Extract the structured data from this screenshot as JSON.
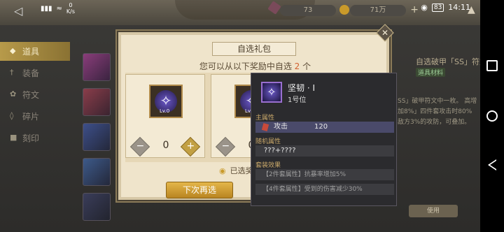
{
  "status_bar": {
    "speed_value": "0",
    "speed_unit": "K/s",
    "battery": "83",
    "time": "14:11"
  },
  "top_bar": {
    "resource_1": "73",
    "resource_2": "71万"
  },
  "sidebar": {
    "items": [
      {
        "label": "道具",
        "icon": "bag-icon",
        "active": true
      },
      {
        "label": "装备",
        "icon": "sword-icon",
        "active": false
      },
      {
        "label": "符文",
        "icon": "rune-icon",
        "active": false
      },
      {
        "label": "碎片",
        "icon": "shard-icon",
        "active": false
      },
      {
        "label": "刻印",
        "icon": "stamp-icon",
        "active": false
      }
    ]
  },
  "right_panel": {
    "title": "自选破甲「SS」符文",
    "tag": "道具材料",
    "desc": "SS」破甲符文中一枚。 高增加8%」四件套攻击时80% 敌方3%的攻防，可叠加。",
    "button": "使用"
  },
  "dialog": {
    "title": "自选礼包",
    "subtitle_prefix": "您可以从以下奖励中自选",
    "subtitle_count": "2",
    "subtitle_suffix": "个",
    "cards": [
      {
        "level": "Lv.0",
        "quantity": "0"
      },
      {
        "level": "Lv.0",
        "quantity": "0"
      }
    ],
    "selected_note": "已选奖",
    "reselect_button": "下次再选",
    "close_glyph": "✕"
  },
  "tooltip": {
    "name": "坚韧 · Ⅰ",
    "slot": "1号位",
    "main_attr_label": "主属性",
    "main_attr_key": "攻击",
    "main_attr_value": "120",
    "random_attr_label": "随机属性",
    "random_attr_value": "???+????",
    "set_effect_label": "套装效果",
    "set_effects": [
      "【2件套属性】抗暴率增加5%",
      "【4件套属性】受到的伤害减少30%"
    ]
  },
  "colors": {
    "accent_gold": "#c2a043",
    "highlight_orange": "#d1602f"
  }
}
